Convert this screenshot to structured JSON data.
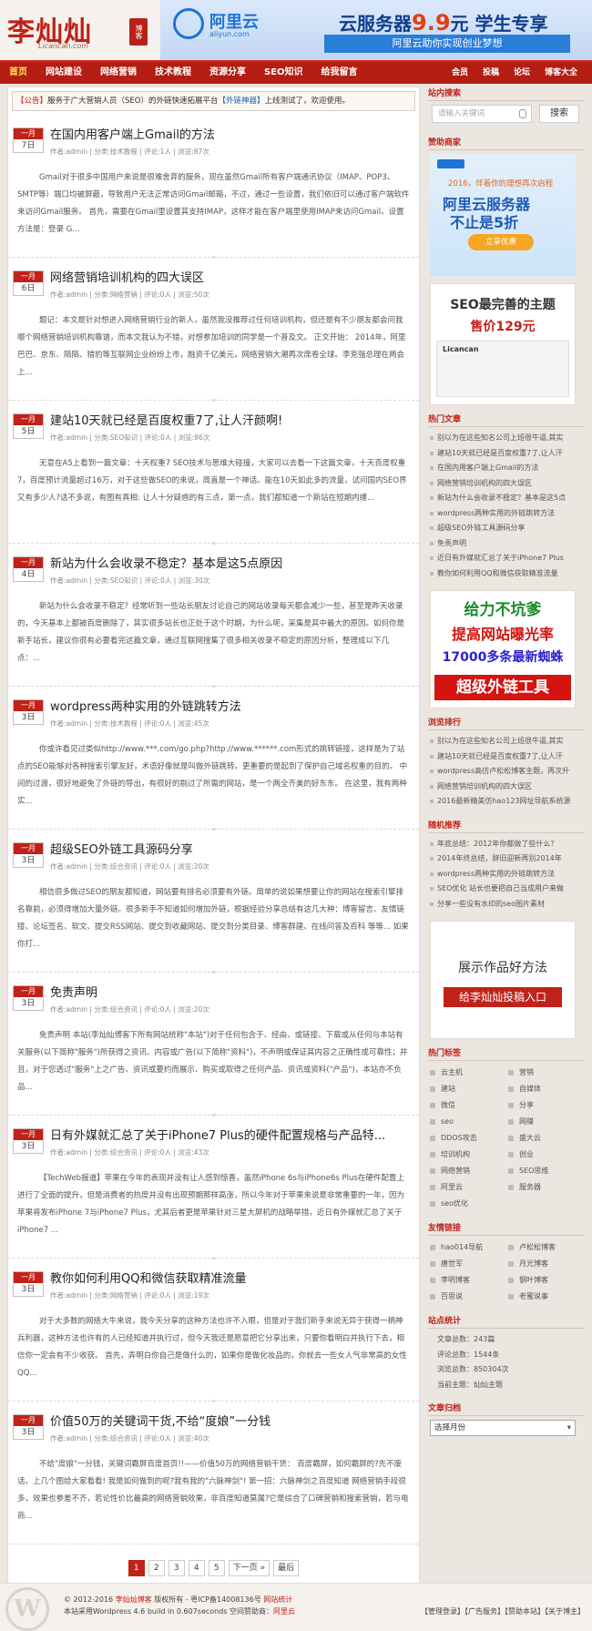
{
  "header": {
    "logo_cn": "李灿灿",
    "logo_en": "Licancan.com",
    "logo_seal": "博客",
    "banner": {
      "brand": "阿里云",
      "brand_sub": "aliyun.com",
      "promo_a": "云服务器",
      "promo_price": "9.9",
      "promo_b": "元 学生专享",
      "tagline": "阿里云助你实现创业梦想"
    }
  },
  "nav": {
    "items": [
      "首页",
      "网站建设",
      "网络营销",
      "技术教程",
      "资源分享",
      "SEO知识",
      "给我留言"
    ],
    "right": [
      "会员",
      "投稿",
      "论坛",
      "博客大全"
    ]
  },
  "notice": {
    "tag": "【公告】",
    "text": "服务于广大营销人员（SEO）的外链快速拓展平台",
    "link": "【外链神器】",
    "tail": "上线测试了，欢迎使用。"
  },
  "posts": [
    {
      "month": "一月",
      "day": "7日",
      "title": "在国内用客户端上Gmail的方法",
      "meta": "作者:admin | 分类:技术教程 | 评论:1人 | 浏览:87次",
      "summary": "Gmail对于很多中国用户来说是很难舍弃的服务，现在虽然Gmail所有客户端通讯协议（IMAP、POP3、SMTP等）端口均被屏蔽，导致用户无法正常访问Gmail邮箱，不过，通过一些设置，我们依旧可以通过客户端软件来访问Gmail服务。 首先，需要在Gmail里设置其支持IMAP，这样才能在客户端里使用IMAP来访问Gmail。设置方法是：登录 G..."
    },
    {
      "month": "一月",
      "day": "6日",
      "title": "网络营销培训机构的四大误区",
      "meta": "作者:admin | 分类:网络营销 | 评论:0人 | 浏览:50次",
      "summary": "题记：本文是针对想进入网络营销行业的新人，虽然我没推荐过任何培训机构，但还是有不少朋友都会问我哪个网络营销培训机构靠谱，而本文我认为不错，对想参加培训的同学是一个普及文。 正文开始： 2014年，阿里巴巴、京东、陌陌、猎豹等互联网企业纷纷上市，融资千亿美元，网络营销大潮再次席卷全球。李克强总理在两会上..."
    },
    {
      "month": "一月",
      "day": "5日",
      "title": "建站10天就已经是百度权重7了,让人汗颜啊!",
      "meta": "作者:admin | 分类:SEO知识 | 评论:0人 | 浏览:86次",
      "summary": "无意在A5上看到一篇文章：十天权重7 SEO技术与思维大碰撞，大家可以去看一下这篇文章，十天百度权重7，百度预计流量超过16万，对于这些做SEO的来说，简直是一个神话。能在10天如此多的流量，试问国内SEO界又有多少人?话不多说，有图有真相: 让人十分疑惑的有三点，第一点，我们都知道一个新站在短期内缠..."
    },
    {
      "month": "一月",
      "day": "4日",
      "title": "新站为什么会收录不稳定？基本是这5点原因",
      "meta": "作者:admin | 分类:SEO知识 | 评论:0人 | 浏览:30次",
      "summary": "新站为什么会收录不稳定？经常听到一些站长朋友讨论自己的网站收录每天都会减少一些，甚至是昨天收录的，今天基本上都被百度删除了，其实很多站长也正处于这个时期，为什么呢，采集是其中最大的原因。如何你是新手站长，建议你很有必要看完这篇文章，通过互联网搜集了很多相关收录不稳定的原因分析，整理成以下几点：..."
    },
    {
      "month": "一月",
      "day": "3日",
      "title": "wordpress两种实用的外链跳转方法",
      "meta": "作者:admin | 分类:技术教程 | 评论:0人 | 浏览:45次",
      "summary": "你或许看见过类似http://www.***.com/go.php?http://www.******.com形式的跳转链接，这样是为了站点的SEO能够对各种搜索引擎友好，术语好像就是叫做外链跳转。更重要的是起到了保护自己域名权重的目的。 中间的过渡，很好地避免了外链的导出，有很好的剔过了所需的网站，是一个两全齐美的好东东。 在这里，我有两种实..."
    },
    {
      "month": "一月",
      "day": "3日",
      "title": "超级SEO外链工具源码分享",
      "meta": "作者:admin | 分类:综合资讯 | 评论:0人 | 浏览:20次",
      "summary": "相信很多做过SEO的朋友都知道，网站要有排名必须要有外链。简单的说如果想要让你的网站在搜索引擎排名靠前，必须得增加大量外链。很多新手不知道如何增加外链，根据经验分享总结有这几大种：博客留言、友情链接、论坛签名、软文、提交RSS网站、提交到收藏网站、提交到分类目录、博客群建、在线问答及百科 等等... 如果你打..."
    },
    {
      "month": "一月",
      "day": "3日",
      "title": "免责声明",
      "meta": "作者:admin | 分类:综合资讯 | 评论:0人 | 浏览:20次",
      "summary": "免责声明 本站(李灿灿博客下所有网站统称\"本站\")对于任何包含于、经由、或链接、下载或从任何与本站有关服务(以下简称\"服务\")所获得之资讯、内容或广告(以下简称\"资料\")，不声明或保证其内容之正确性或可靠性；并且，对于您透过\"服务\"上之广告、资讯或要约而展示、购买或取得之任何产品、资讯或资料(\"产品\")，本站亦不负品..."
    },
    {
      "month": "一月",
      "day": "3日",
      "title": "日有外媒就汇总了关于iPhone7 Plus的硬件配置规格与产品特...",
      "meta": "作者:admin | 分类:综合资讯 | 评论:0人 | 浏览:43次",
      "summary": "【TechWeb报道】苹果在今年的表现并没有让人感到惊喜，虽然iPhone 6s与iPhone6s Plus在硬件配置上进行了全面的提升，但是消费者的热度并没有出现预期那样高涨，所以今年对于苹果来说是非常重要的一年，因为苹果将发布iPhone 7与iPhone7 Plus，尤其后者更是苹果针对三星大屏机的战略举措，近日有外媒就汇总了关于iPhone7 ..."
    },
    {
      "month": "一月",
      "day": "3日",
      "title": "教你如何利用QQ和微信获取精准流量",
      "meta": "作者:admin | 分类:网络营销 | 评论:0人 | 浏览:19次",
      "summary": "对于大多数的网络大牛来说，我今天分享的这种方法也许不入眼，但是对于我们新手来说无异于获得一柄神兵利器，这种方法也许有的人已经知道并执行过，但今天我还是愿意把它分享出来，只要你看明白并执行下去，相信你一定会有不少收获。 首先，弄明白你自己是做什么的，如果你是做化妆品的，你就去一些女人气非常高的女性QQ..."
    },
    {
      "month": "一月",
      "day": "3日",
      "title": "价值50万的关键词干货,不给“度娘”一分钱",
      "meta": "作者:admin | 分类:综合资讯 | 评论:0人 | 浏览:40次",
      "summary": "不给\"度娘\"一分钱，关键词霸屏百度首页!!——价值50万的网络营销干货： 百度霸屏，如何霸屏的?先不废话，上几个图给大家看看! 我是如何做到的呢?我有我的\"六脉神剑\"! 第一招：六脉神剑之百度知道 网络营销手段很多，效果也参差不齐，若论性价比最高的网络营销效果，非百度知道莫属?它是综合了口碑营销和搜索营销，若与电商..."
    }
  ],
  "pager": {
    "pages": [
      "1",
      "2",
      "3",
      "4",
      "5"
    ],
    "next": "下一页 »",
    "last": "最后"
  },
  "sidebar": {
    "search": {
      "title": "站内搜索",
      "placeholder": "请输入关键词",
      "button": "搜索"
    },
    "sponsor": {
      "title": "赞助商家",
      "ad1": {
        "line1": "2016，伴着你的理想再次启程",
        "line2": "阿里云服务器",
        "line3": "不止是5折",
        "button": "立享优惠"
      },
      "ad2": {
        "line1": "SEO最完善的主题",
        "line2": "售价129元",
        "brand": "Licancan"
      }
    },
    "hot": {
      "title": "热门文章",
      "items": [
        "别以为在这些知名公司上班很牛逼,其实",
        "建站10天就已经是百度权重7了,让人汗",
        "在国内用客户端上Gmail的方法",
        "网络营销培训机构的四大误区",
        "新站为什么会收录不稳定？基本是这5点",
        "wordpress两种实用的外链跳转方法",
        "超级SEO外链工具源码分享",
        "免责声明",
        "近日有外媒就汇总了关于iPhone7 Plus",
        "教你如何利用QQ和微信获取精准流量"
      ]
    },
    "ad3": {
      "r1": "给力不坑爹",
      "r2": "提高网站曝光率",
      "r3": "17000多条最新蜘蛛",
      "r4": "超级外链工具"
    },
    "views": {
      "title": "浏览排行",
      "items": [
        "别以为在这些知名公司上班很牛逼,其实",
        "建站10天就已经是百度权重7了,让人汗",
        "wordpress高仿卢松松博客主题，再次升",
        "网络营销培训机构的四大误区",
        "2016最新精美仿hao123网址导航系统源"
      ]
    },
    "random": {
      "title": "随机推荐",
      "items": [
        "年底总结：2012年你都做了些什么？",
        "2014年终总结，辞旧迎新再别2014年",
        "wordpress两种实用的外链跳转方法",
        "SEO优化 站长也要把自己当成用户来做",
        "分享一些没有水印的seo图片素材"
      ]
    },
    "ad4": {
      "line1": "展示作品好方法",
      "button": "给李灿灿投稿入口"
    },
    "tags": {
      "title": "热门标签",
      "items": [
        "云主机",
        "营销",
        "建站",
        "自媒体",
        "微信",
        "分享",
        "seo",
        "网赚",
        "DDOS攻击",
        "盛大云",
        "培训机构",
        "创业",
        "网络营销",
        "SEO思维",
        "阿里云",
        "服务器",
        "seo优化"
      ]
    },
    "links": {
      "title": "友情链接",
      "items": [
        "hao014导航",
        "卢松松博客",
        "唐世军",
        "月光博客",
        "李明博客",
        "钢叶博客",
        "百思说",
        "老蜜说事"
      ]
    },
    "stats": {
      "title": "站点统计",
      "items": [
        "文章总数：243篇",
        "评论总数：1544条",
        "浏览总数：850304次",
        "当前主题：灿灿主题"
      ]
    },
    "archive": {
      "title": "文章归档",
      "select": "选择月份"
    }
  },
  "footer": {
    "logo": "W",
    "copy_a": "© 2012-2016 ",
    "site": "李灿灿博客",
    "copy_b": " 版权所有 - 粤ICP备14008136号 ",
    "stat": "网站统计",
    "power": "本站采用Wordpress 4.6 build in 0.607seconds 空间赞助商：",
    "host": "阿里云",
    "links": "【管理登录】【广告服务】【赞助本站】【关于博主】"
  }
}
